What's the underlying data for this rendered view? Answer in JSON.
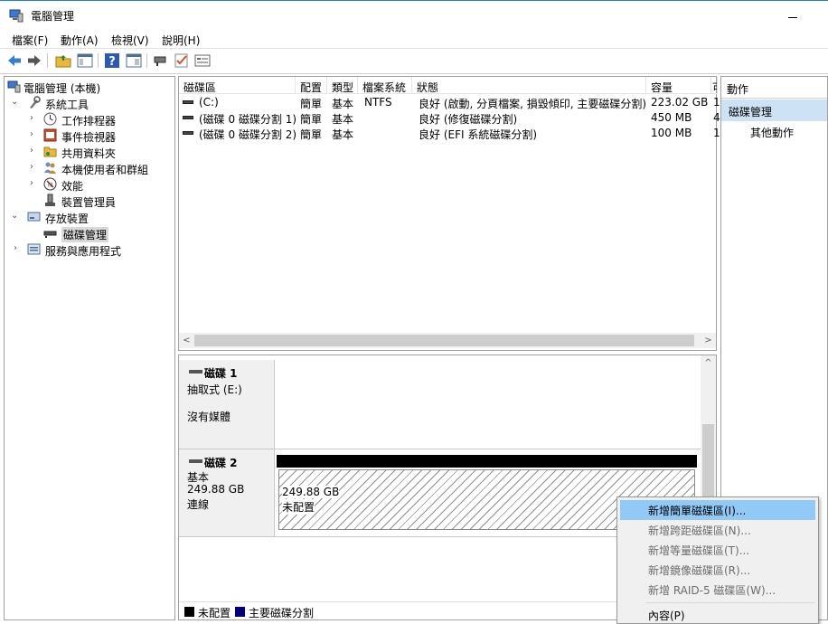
{
  "window": {
    "title": "電腦管理"
  },
  "menu": [
    "檔案(F)",
    "動作(A)",
    "檢視(V)",
    "說明(H)"
  ],
  "toolbar": {
    "buttons": [
      "back-icon",
      "forward-icon",
      "up-folder-icon",
      "show-hide-tree-icon",
      "help-icon",
      "show-hide-action-pane-icon",
      "connect-icon",
      "check-icon",
      "properties-icon"
    ]
  },
  "tree": {
    "root": "電腦管理 (本機)",
    "system_tools": "系統工具",
    "task_scheduler": "工作排程器",
    "event_viewer": "事件檢視器",
    "shared_folders": "共用資料夾",
    "local_users": "本機使用者和群組",
    "performance": "效能",
    "device_manager": "裝置管理員",
    "storage": "存放裝置",
    "disk_management": "磁碟管理",
    "services": "服務與應用程式"
  },
  "columns": [
    "磁碟區",
    "配置",
    "類型",
    "檔案系統",
    "狀態",
    "容量",
    "可"
  ],
  "volumes": [
    {
      "name": "(C:)",
      "layout": "簡單",
      "type": "基本",
      "fs": "NTFS",
      "status": "良好 (啟動, 分頁檔案, 損毀傾印, 主要磁碟分割)",
      "capacity": "223.02 GB",
      "free": "1"
    },
    {
      "name": "(磁碟 0 磁碟分割 1)",
      "layout": "簡單",
      "type": "基本",
      "fs": "",
      "status": "良好 (修復磁碟分割)",
      "capacity": "450 MB",
      "free": "4"
    },
    {
      "name": "(磁碟 0 磁碟分割 2)",
      "layout": "簡單",
      "type": "基本",
      "fs": "",
      "status": "良好 (EFI 系統磁碟分割)",
      "capacity": "100 MB",
      "free": "1"
    }
  ],
  "disks": [
    {
      "name": "磁碟 1",
      "type": "抽取式 (E:)",
      "media": "沒有媒體"
    },
    {
      "name": "磁碟 2",
      "type": "基本",
      "size": "249.88 GB",
      "state": "連線",
      "partition_size": "249.88 GB",
      "partition_state": "未配置"
    }
  ],
  "legend": [
    {
      "label": "未配置",
      "color": "#000000"
    },
    {
      "label": "主要磁碟分割",
      "color": "#000080"
    }
  ],
  "actions": {
    "header": "動作",
    "section": "磁碟管理",
    "more": "其他動作"
  },
  "context_menu": {
    "items": [
      {
        "label": "新增簡單磁碟區(I)...",
        "enabled": true
      },
      {
        "label": "新增跨距磁碟區(N)...",
        "enabled": false
      },
      {
        "label": "新增等量磁碟區(T)...",
        "enabled": false
      },
      {
        "label": "新增鏡像磁碟區(R)...",
        "enabled": false
      },
      {
        "label": "新增 RAID-5 磁碟區(W)...",
        "enabled": false
      }
    ],
    "properties": "內容(P)"
  },
  "colors": {
    "selection": "#cde3f5",
    "menu_highlight": "#91c9f7",
    "title_accent": "#1883d7"
  }
}
